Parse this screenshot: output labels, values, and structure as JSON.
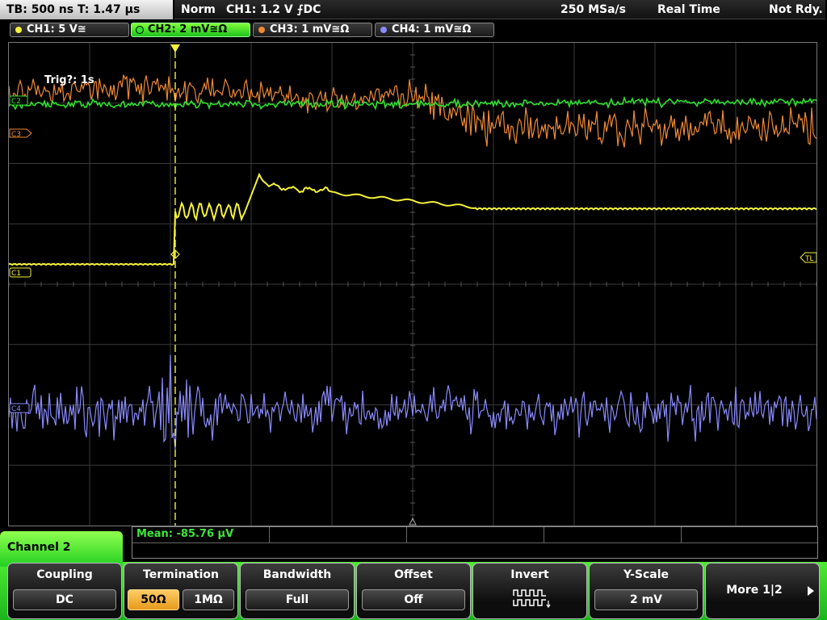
{
  "topbar": {
    "timebase": "TB: 500 ns   T: 1.47 µs",
    "trigger_mode": "Norm",
    "trigger_source": "CH1: 1.2 V ⨍DC",
    "sample_rate": "250 MSa/s",
    "acq_mode": "Real Time",
    "status": "Not Rdy."
  },
  "channels": [
    {
      "label": "CH1: 5 V≅",
      "color": "#f5f23a"
    },
    {
      "label": "CH2: 2 mV≅Ω",
      "color": "#2fe02f"
    },
    {
      "label": "CH3: 1 mV≅Ω",
      "color": "#f08a34"
    },
    {
      "label": "CH4: 1 mV≅Ω",
      "color": "#8a8aff"
    }
  ],
  "screen": {
    "trigger_info": "Trig?: 1s",
    "markers": {
      "c1": "C1",
      "c2": "C2",
      "c3": "C3",
      "c4": "C4",
      "tl": "TL"
    }
  },
  "measurement": {
    "text": "Mean: -85.76 µV"
  },
  "menu": {
    "title": "Channel 2",
    "softkeys": {
      "coupling": {
        "label": "Coupling",
        "value": "DC"
      },
      "termination": {
        "label": "Termination",
        "value_a": "50Ω",
        "value_b": "1MΩ"
      },
      "bandwidth": {
        "label": "Bandwidth",
        "value": "Full"
      },
      "offset": {
        "label": "Offset",
        "value": "Off"
      },
      "invert": {
        "label": "Invert"
      },
      "yscale": {
        "label": "Y-Scale",
        "value": "2 mV"
      },
      "more": {
        "label": "More 1|2"
      }
    }
  }
}
